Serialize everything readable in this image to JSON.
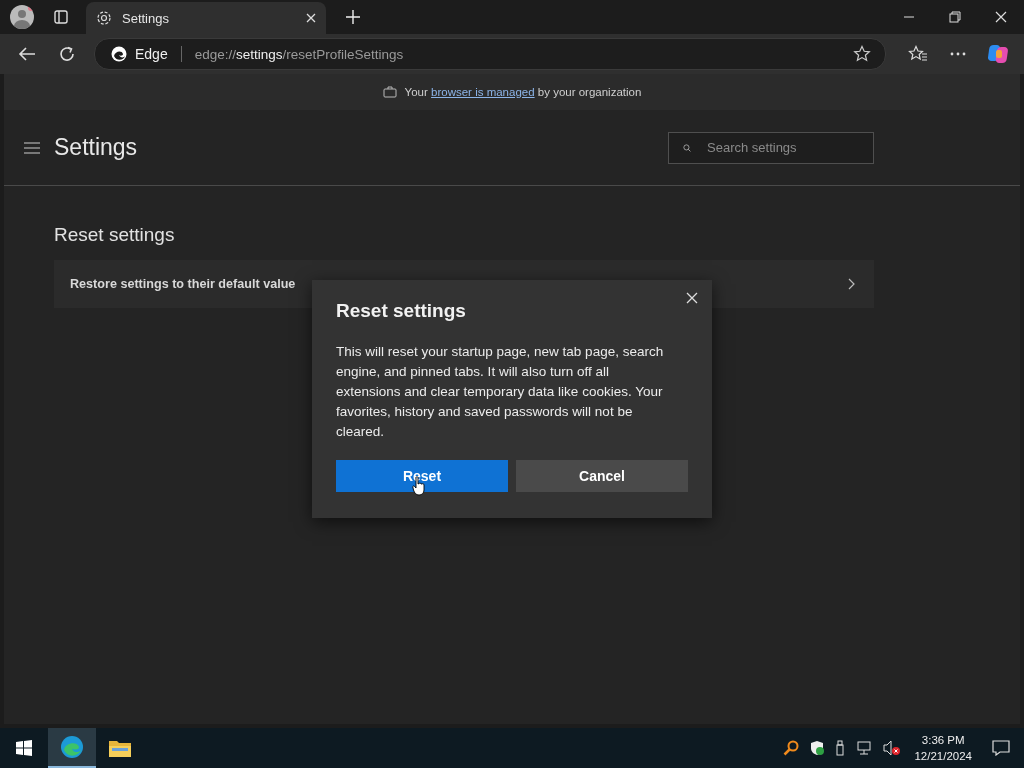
{
  "tabs": [
    {
      "label": "Settings",
      "selected": true
    }
  ],
  "address_bar": {
    "site_label": "Edge",
    "url_parts": [
      {
        "text": "edge://",
        "emphasis": false
      },
      {
        "text": "settings",
        "emphasis": true
      },
      {
        "text": "/resetProfileSettings",
        "emphasis": false
      }
    ]
  },
  "managed_banner": {
    "before": "Your",
    "link": "browser is managed",
    "after": "by your organization"
  },
  "settings_header": {
    "title": "Settings",
    "search": {
      "placeholder": "Search settings"
    }
  },
  "section": {
    "title": "Reset settings",
    "items": [
      {
        "label": "Restore settings to their default value"
      }
    ]
  },
  "dialog": {
    "title": "Reset settings",
    "message": "This will reset your startup page, new tab page, search engine, and pinned tabs. It will also turn off all extensions and clear temporary data like cookies. Your favorites, history and saved passwords will not be cleared.",
    "buttons": [
      {
        "label": "Reset",
        "kind": "primary"
      },
      {
        "label": "Cancel",
        "kind": "secondary"
      }
    ]
  },
  "taskbar": {
    "apps": [
      {
        "kind": "edge",
        "selected": true
      },
      {
        "kind": "folder",
        "selected": false
      }
    ],
    "time": "3:36 PM",
    "date": "12/21/2024"
  }
}
